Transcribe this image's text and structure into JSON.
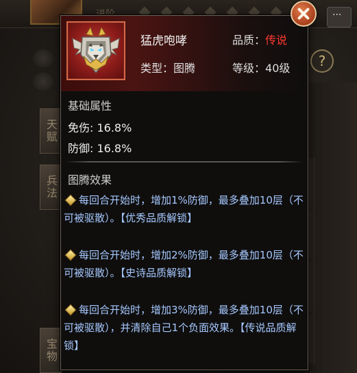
{
  "background": {
    "top_label": "进阶",
    "tabs": [
      {
        "label": "天赋",
        "icon": "talent"
      },
      {
        "label": "兵法",
        "icon": "tactics"
      },
      {
        "label": "宝物",
        "icon": "treasure"
      }
    ],
    "help_label": "?"
  },
  "tooltip": {
    "name": "猛虎咆哮",
    "icon": "tiger-totem-icon",
    "type_label": "类型：",
    "type_value": "图腾",
    "quality_label": "品质：",
    "quality_value": "传说",
    "level_label": "等级：",
    "level_value": "40级",
    "colors": {
      "quality": "#ff3a30",
      "effect_text": "#a6c8ff",
      "header_bg": "#4a1412"
    },
    "base_attr_title": "基础属性",
    "attributes": [
      {
        "label": "免伤: 16.8%"
      },
      {
        "label": "防御: 16.8%"
      }
    ],
    "effect_title": "图腾效果",
    "effects": [
      {
        "text": "每回合开始时，增加1%防御，最多叠加10层（不可被驱散）。",
        "unlock": "【优秀品质解锁】"
      },
      {
        "text": "每回合开始时，增加2%防御，最多叠加10层（不可被驱散）。",
        "unlock": "【史诗品质解锁】"
      },
      {
        "text": "每回合开始时，增加3%防御，最多叠加10层（不可被驱散），并清除自己1个负面效果。",
        "unlock": "【传说品质解锁】"
      }
    ]
  }
}
